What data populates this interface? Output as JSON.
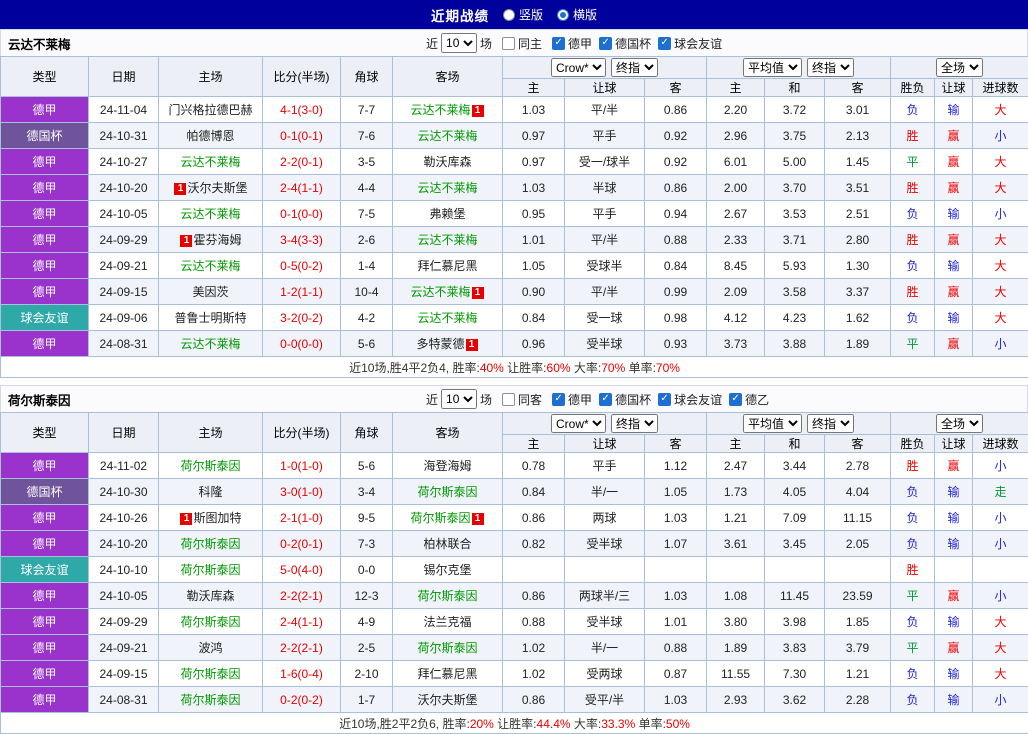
{
  "colors": {
    "league": {
      "德甲": "#9933CC",
      "德国杯": "#70549B",
      "球会友谊": "#2FA8A8",
      "德乙": "#3355BB"
    },
    "result": {
      "r": "#EE0000",
      "b": "#2323D5",
      "g": "#009933",
      "k": "#333333"
    },
    "focus_team": "#009900",
    "score": "#E60000",
    "badge": "#E80000"
  },
  "topbar": {
    "title": "近期战绩",
    "layout_options": [
      {
        "label": "竖版",
        "selected": false
      },
      {
        "label": "横版",
        "selected": true
      }
    ]
  },
  "table": {
    "left_headers": [
      "类型",
      "日期",
      "主场",
      "比分(半场)",
      "角球",
      "客场"
    ],
    "group1_selects": [
      "Crow*",
      "终指"
    ],
    "group1_headers": [
      "主",
      "让球",
      "客"
    ],
    "group2_selects": [
      "平均值",
      "终指"
    ],
    "group2_headers": [
      "主",
      "和",
      "客"
    ],
    "group3_selects": [
      "全场"
    ],
    "group3_headers": [
      "胜负",
      "让球",
      "进球数"
    ]
  },
  "sections": [
    {
      "team": "云达不莱梅",
      "filters": {
        "near_label": "近",
        "count": "10",
        "unit_label": "场",
        "same_label": "同主",
        "same_checked": false,
        "leagues": [
          {
            "label": "德甲",
            "checked": true
          },
          {
            "label": "德国杯",
            "checked": true
          },
          {
            "label": "球会友谊",
            "checked": true
          }
        ]
      },
      "rows": [
        {
          "type": "德甲",
          "date": "24-11-04",
          "home": {
            "name": "门兴格拉德巴赫",
            "focus": false,
            "badge": ""
          },
          "score": "4-1(3-0)",
          "corners": "7-7",
          "away": {
            "name": "云达不莱梅",
            "focus": true,
            "badge": "after"
          },
          "odds": [
            "1.03",
            "平/半",
            "0.86"
          ],
          "avg": [
            "2.20",
            "3.72",
            "3.01"
          ],
          "results": [
            {
              "t": "负",
              "c": "b"
            },
            {
              "t": "输",
              "c": "b"
            },
            {
              "t": "大",
              "c": "r"
            }
          ]
        },
        {
          "type": "德国杯",
          "date": "24-10-31",
          "home": {
            "name": "帕德博恩",
            "focus": false,
            "badge": ""
          },
          "score": "0-1(0-1)",
          "corners": "7-6",
          "away": {
            "name": "云达不莱梅",
            "focus": true,
            "badge": ""
          },
          "odds": [
            "0.97",
            "平手",
            "0.92"
          ],
          "avg": [
            "2.96",
            "3.75",
            "2.13"
          ],
          "results": [
            {
              "t": "胜",
              "c": "r"
            },
            {
              "t": "赢",
              "c": "r"
            },
            {
              "t": "小",
              "c": "b"
            }
          ]
        },
        {
          "type": "德甲",
          "date": "24-10-27",
          "home": {
            "name": "云达不莱梅",
            "focus": true,
            "badge": ""
          },
          "score": "2-2(0-1)",
          "corners": "3-5",
          "away": {
            "name": "勒沃库森",
            "focus": false,
            "badge": ""
          },
          "odds": [
            "0.97",
            "受一/球半",
            "0.92"
          ],
          "avg": [
            "6.01",
            "5.00",
            "1.45"
          ],
          "results": [
            {
              "t": "平",
              "c": "g"
            },
            {
              "t": "赢",
              "c": "r"
            },
            {
              "t": "大",
              "c": "r"
            }
          ]
        },
        {
          "type": "德甲",
          "date": "24-10-20",
          "home": {
            "name": "沃尔夫斯堡",
            "focus": false,
            "badge": "before"
          },
          "score": "2-4(1-1)",
          "corners": "4-4",
          "away": {
            "name": "云达不莱梅",
            "focus": true,
            "badge": ""
          },
          "odds": [
            "1.03",
            "半球",
            "0.86"
          ],
          "avg": [
            "2.00",
            "3.70",
            "3.51"
          ],
          "results": [
            {
              "t": "胜",
              "c": "r"
            },
            {
              "t": "赢",
              "c": "r"
            },
            {
              "t": "大",
              "c": "r"
            }
          ]
        },
        {
          "type": "德甲",
          "date": "24-10-05",
          "home": {
            "name": "云达不莱梅",
            "focus": true,
            "badge": ""
          },
          "score": "0-1(0-0)",
          "corners": "7-5",
          "away": {
            "name": "弗赖堡",
            "focus": false,
            "badge": ""
          },
          "odds": [
            "0.95",
            "平手",
            "0.94"
          ],
          "avg": [
            "2.67",
            "3.53",
            "2.51"
          ],
          "results": [
            {
              "t": "负",
              "c": "b"
            },
            {
              "t": "输",
              "c": "b"
            },
            {
              "t": "小",
              "c": "b"
            }
          ]
        },
        {
          "type": "德甲",
          "date": "24-09-29",
          "home": {
            "name": "霍芬海姆",
            "focus": false,
            "badge": "before"
          },
          "score": "3-4(3-3)",
          "corners": "2-6",
          "away": {
            "name": "云达不莱梅",
            "focus": true,
            "badge": ""
          },
          "odds": [
            "1.01",
            "平/半",
            "0.88"
          ],
          "avg": [
            "2.33",
            "3.71",
            "2.80"
          ],
          "results": [
            {
              "t": "胜",
              "c": "r"
            },
            {
              "t": "赢",
              "c": "r"
            },
            {
              "t": "大",
              "c": "r"
            }
          ]
        },
        {
          "type": "德甲",
          "date": "24-09-21",
          "home": {
            "name": "云达不莱梅",
            "focus": true,
            "badge": ""
          },
          "score": "0-5(0-2)",
          "corners": "1-4",
          "away": {
            "name": "拜仁慕尼黑",
            "focus": false,
            "badge": ""
          },
          "odds": [
            "1.05",
            "受球半",
            "0.84"
          ],
          "avg": [
            "8.45",
            "5.93",
            "1.30"
          ],
          "results": [
            {
              "t": "负",
              "c": "b"
            },
            {
              "t": "输",
              "c": "b"
            },
            {
              "t": "大",
              "c": "r"
            }
          ]
        },
        {
          "type": "德甲",
          "date": "24-09-15",
          "home": {
            "name": "美因茨",
            "focus": false,
            "badge": ""
          },
          "score": "1-2(1-1)",
          "corners": "10-4",
          "away": {
            "name": "云达不莱梅",
            "focus": true,
            "badge": "after"
          },
          "odds": [
            "0.90",
            "平/半",
            "0.99"
          ],
          "avg": [
            "2.09",
            "3.58",
            "3.37"
          ],
          "results": [
            {
              "t": "胜",
              "c": "r"
            },
            {
              "t": "赢",
              "c": "r"
            },
            {
              "t": "大",
              "c": "r"
            }
          ]
        },
        {
          "type": "球会友谊",
          "date": "24-09-06",
          "home": {
            "name": "普鲁士明斯特",
            "focus": false,
            "badge": ""
          },
          "score": "3-2(0-2)",
          "corners": "4-2",
          "away": {
            "name": "云达不莱梅",
            "focus": true,
            "badge": ""
          },
          "odds": [
            "0.84",
            "受一球",
            "0.98"
          ],
          "avg": [
            "4.12",
            "4.23",
            "1.62"
          ],
          "results": [
            {
              "t": "负",
              "c": "b"
            },
            {
              "t": "输",
              "c": "b"
            },
            {
              "t": "大",
              "c": "r"
            }
          ]
        },
        {
          "type": "德甲",
          "date": "24-08-31",
          "home": {
            "name": "云达不莱梅",
            "focus": true,
            "badge": ""
          },
          "score": "0-0(0-0)",
          "corners": "5-6",
          "away": {
            "name": "多特蒙德",
            "focus": false,
            "badge": "after"
          },
          "odds": [
            "0.96",
            "受半球",
            "0.93"
          ],
          "avg": [
            "3.73",
            "3.88",
            "1.89"
          ],
          "results": [
            {
              "t": "平",
              "c": "g"
            },
            {
              "t": "赢",
              "c": "r"
            },
            {
              "t": "小",
              "c": "b"
            }
          ]
        }
      ],
      "summary": [
        {
          "t": "近10场,胜4平2负4, 胜率:",
          "c": "k"
        },
        {
          "t": "40%",
          "c": "r"
        },
        {
          "t": "  让胜率:",
          "c": "k"
        },
        {
          "t": "60%",
          "c": "r"
        },
        {
          "t": "  大率:",
          "c": "k"
        },
        {
          "t": "70%",
          "c": "r"
        },
        {
          "t": "  单率:",
          "c": "k"
        },
        {
          "t": "70%",
          "c": "r"
        }
      ]
    },
    {
      "team": "荷尔斯泰因",
      "filters": {
        "near_label": "近",
        "count": "10",
        "unit_label": "场",
        "same_label": "同客",
        "same_checked": false,
        "leagues": [
          {
            "label": "德甲",
            "checked": true
          },
          {
            "label": "德国杯",
            "checked": true
          },
          {
            "label": "球会友谊",
            "checked": true
          },
          {
            "label": "德乙",
            "checked": true
          }
        ]
      },
      "rows": [
        {
          "type": "德甲",
          "date": "24-11-02",
          "home": {
            "name": "荷尔斯泰因",
            "focus": true,
            "badge": ""
          },
          "score": "1-0(1-0)",
          "corners": "5-6",
          "away": {
            "name": "海登海姆",
            "focus": false,
            "badge": ""
          },
          "odds": [
            "0.78",
            "平手",
            "1.12"
          ],
          "avg": [
            "2.47",
            "3.44",
            "2.78"
          ],
          "results": [
            {
              "t": "胜",
              "c": "r"
            },
            {
              "t": "赢",
              "c": "r"
            },
            {
              "t": "小",
              "c": "b"
            }
          ]
        },
        {
          "type": "德国杯",
          "date": "24-10-30",
          "home": {
            "name": "科隆",
            "focus": false,
            "badge": ""
          },
          "score": "3-0(1-0)",
          "corners": "3-4",
          "away": {
            "name": "荷尔斯泰因",
            "focus": true,
            "badge": ""
          },
          "odds": [
            "0.84",
            "半/一",
            "1.05"
          ],
          "avg": [
            "1.73",
            "4.05",
            "4.04"
          ],
          "results": [
            {
              "t": "负",
              "c": "b"
            },
            {
              "t": "输",
              "c": "b"
            },
            {
              "t": "走",
              "c": "g"
            }
          ]
        },
        {
          "type": "德甲",
          "date": "24-10-26",
          "home": {
            "name": "斯图加特",
            "focus": false,
            "badge": "before"
          },
          "score": "2-1(1-0)",
          "corners": "9-5",
          "away": {
            "name": "荷尔斯泰因",
            "focus": true,
            "badge": "after"
          },
          "odds": [
            "0.86",
            "两球",
            "1.03"
          ],
          "avg": [
            "1.21",
            "7.09",
            "11.15"
          ],
          "results": [
            {
              "t": "负",
              "c": "b"
            },
            {
              "t": "输",
              "c": "b"
            },
            {
              "t": "小",
              "c": "b"
            }
          ]
        },
        {
          "type": "德甲",
          "date": "24-10-20",
          "home": {
            "name": "荷尔斯泰因",
            "focus": true,
            "badge": ""
          },
          "score": "0-2(0-1)",
          "corners": "7-3",
          "away": {
            "name": "柏林联合",
            "focus": false,
            "badge": ""
          },
          "odds": [
            "0.82",
            "受半球",
            "1.07"
          ],
          "avg": [
            "3.61",
            "3.45",
            "2.05"
          ],
          "results": [
            {
              "t": "负",
              "c": "b"
            },
            {
              "t": "输",
              "c": "b"
            },
            {
              "t": "小",
              "c": "b"
            }
          ]
        },
        {
          "type": "球会友谊",
          "date": "24-10-10",
          "home": {
            "name": "荷尔斯泰因",
            "focus": true,
            "badge": ""
          },
          "score": "5-0(4-0)",
          "corners": "0-0",
          "away": {
            "name": "锡尔克堡",
            "focus": false,
            "badge": ""
          },
          "odds": [
            "",
            "",
            ""
          ],
          "avg": [
            "",
            "",
            ""
          ],
          "results": [
            {
              "t": "胜",
              "c": "r"
            },
            {
              "t": "",
              "c": ""
            },
            {
              "t": "",
              "c": ""
            }
          ]
        },
        {
          "type": "德甲",
          "date": "24-10-05",
          "home": {
            "name": "勒沃库森",
            "focus": false,
            "badge": ""
          },
          "score": "2-2(2-1)",
          "corners": "12-3",
          "away": {
            "name": "荷尔斯泰因",
            "focus": true,
            "badge": ""
          },
          "odds": [
            "0.86",
            "两球半/三",
            "1.03"
          ],
          "avg": [
            "1.08",
            "11.45",
            "23.59"
          ],
          "results": [
            {
              "t": "平",
              "c": "g"
            },
            {
              "t": "赢",
              "c": "r"
            },
            {
              "t": "小",
              "c": "b"
            }
          ]
        },
        {
          "type": "德甲",
          "date": "24-09-29",
          "home": {
            "name": "荷尔斯泰因",
            "focus": true,
            "badge": ""
          },
          "score": "2-4(1-1)",
          "corners": "4-9",
          "away": {
            "name": "法兰克福",
            "focus": false,
            "badge": ""
          },
          "odds": [
            "0.88",
            "受半球",
            "1.01"
          ],
          "avg": [
            "3.80",
            "3.98",
            "1.85"
          ],
          "results": [
            {
              "t": "负",
              "c": "b"
            },
            {
              "t": "输",
              "c": "b"
            },
            {
              "t": "大",
              "c": "r"
            }
          ]
        },
        {
          "type": "德甲",
          "date": "24-09-21",
          "home": {
            "name": "波鸿",
            "focus": false,
            "badge": ""
          },
          "score": "2-2(2-1)",
          "corners": "2-5",
          "away": {
            "name": "荷尔斯泰因",
            "focus": true,
            "badge": ""
          },
          "odds": [
            "1.02",
            "半/一",
            "0.88"
          ],
          "avg": [
            "1.89",
            "3.83",
            "3.79"
          ],
          "results": [
            {
              "t": "平",
              "c": "g"
            },
            {
              "t": "赢",
              "c": "r"
            },
            {
              "t": "大",
              "c": "r"
            }
          ]
        },
        {
          "type": "德甲",
          "date": "24-09-15",
          "home": {
            "name": "荷尔斯泰因",
            "focus": true,
            "badge": ""
          },
          "score": "1-6(0-4)",
          "corners": "2-10",
          "away": {
            "name": "拜仁慕尼黑",
            "focus": false,
            "badge": ""
          },
          "odds": [
            "1.02",
            "受两球",
            "0.87"
          ],
          "avg": [
            "11.55",
            "7.30",
            "1.21"
          ],
          "results": [
            {
              "t": "负",
              "c": "b"
            },
            {
              "t": "输",
              "c": "b"
            },
            {
              "t": "大",
              "c": "r"
            }
          ]
        },
        {
          "type": "德甲",
          "date": "24-08-31",
          "home": {
            "name": "荷尔斯泰因",
            "focus": true,
            "badge": ""
          },
          "score": "0-2(0-2)",
          "corners": "1-7",
          "away": {
            "name": "沃尔夫斯堡",
            "focus": false,
            "badge": ""
          },
          "odds": [
            "0.86",
            "受平/半",
            "1.03"
          ],
          "avg": [
            "2.93",
            "3.62",
            "2.28"
          ],
          "results": [
            {
              "t": "负",
              "c": "b"
            },
            {
              "t": "输",
              "c": "b"
            },
            {
              "t": "小",
              "c": "b"
            }
          ]
        }
      ],
      "summary": [
        {
          "t": "近10场,胜2平2负6, 胜率:",
          "c": "k"
        },
        {
          "t": "20%",
          "c": "r"
        },
        {
          "t": "  让胜率:",
          "c": "k"
        },
        {
          "t": "44.4%",
          "c": "r"
        },
        {
          "t": "  大率:",
          "c": "k"
        },
        {
          "t": "33.3%",
          "c": "r"
        },
        {
          "t": "  单率:",
          "c": "k"
        },
        {
          "t": "50%",
          "c": "r"
        }
      ]
    }
  ]
}
